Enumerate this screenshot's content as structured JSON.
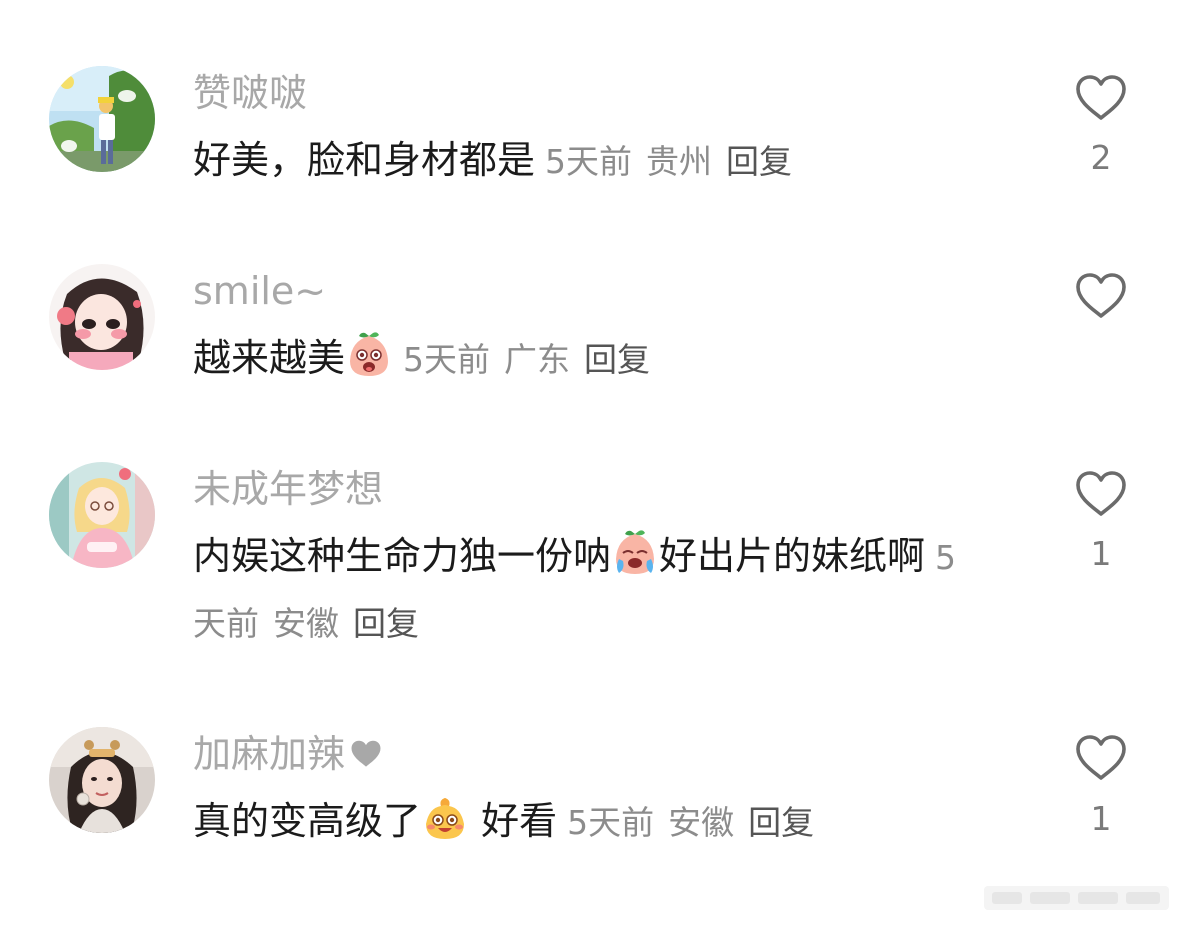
{
  "comments": [
    {
      "username": "赞啵啵",
      "text": "好美，脸和身材都是",
      "text_after_emoji": "",
      "time": "5天前",
      "location": "贵州",
      "reply": "回复",
      "likes": "2"
    },
    {
      "username": "smile~",
      "text": "越来越美",
      "text_after_emoji": "",
      "time": "5天前",
      "location": "广东",
      "reply": "回复",
      "likes": ""
    },
    {
      "username": "未成年梦想",
      "text": "内娱这种生命力独一份呐",
      "text_after_emoji": "好出片的妹纸啊",
      "time": "5天前",
      "location": "安徽",
      "reply": "回复",
      "likes": "1"
    },
    {
      "username": "加麻加辣",
      "text": "真的变高级了",
      "text_after_emoji": " 好看",
      "time": "5天前",
      "location": "安徽",
      "reply": "回复",
      "likes": "1"
    }
  ],
  "colors": {
    "username": "#a8a8a8",
    "body": "#1b1b1b",
    "meta": "#8c8c8c",
    "icon": "#6b6b6b"
  },
  "icons": {
    "like": "heart-outline-icon",
    "username_badge": "heart-filled-icon",
    "emoji_1": "surprised-peach-emoji",
    "emoji_2": "crying-peach-emoji",
    "emoji_3": "happy-bun-emoji"
  }
}
